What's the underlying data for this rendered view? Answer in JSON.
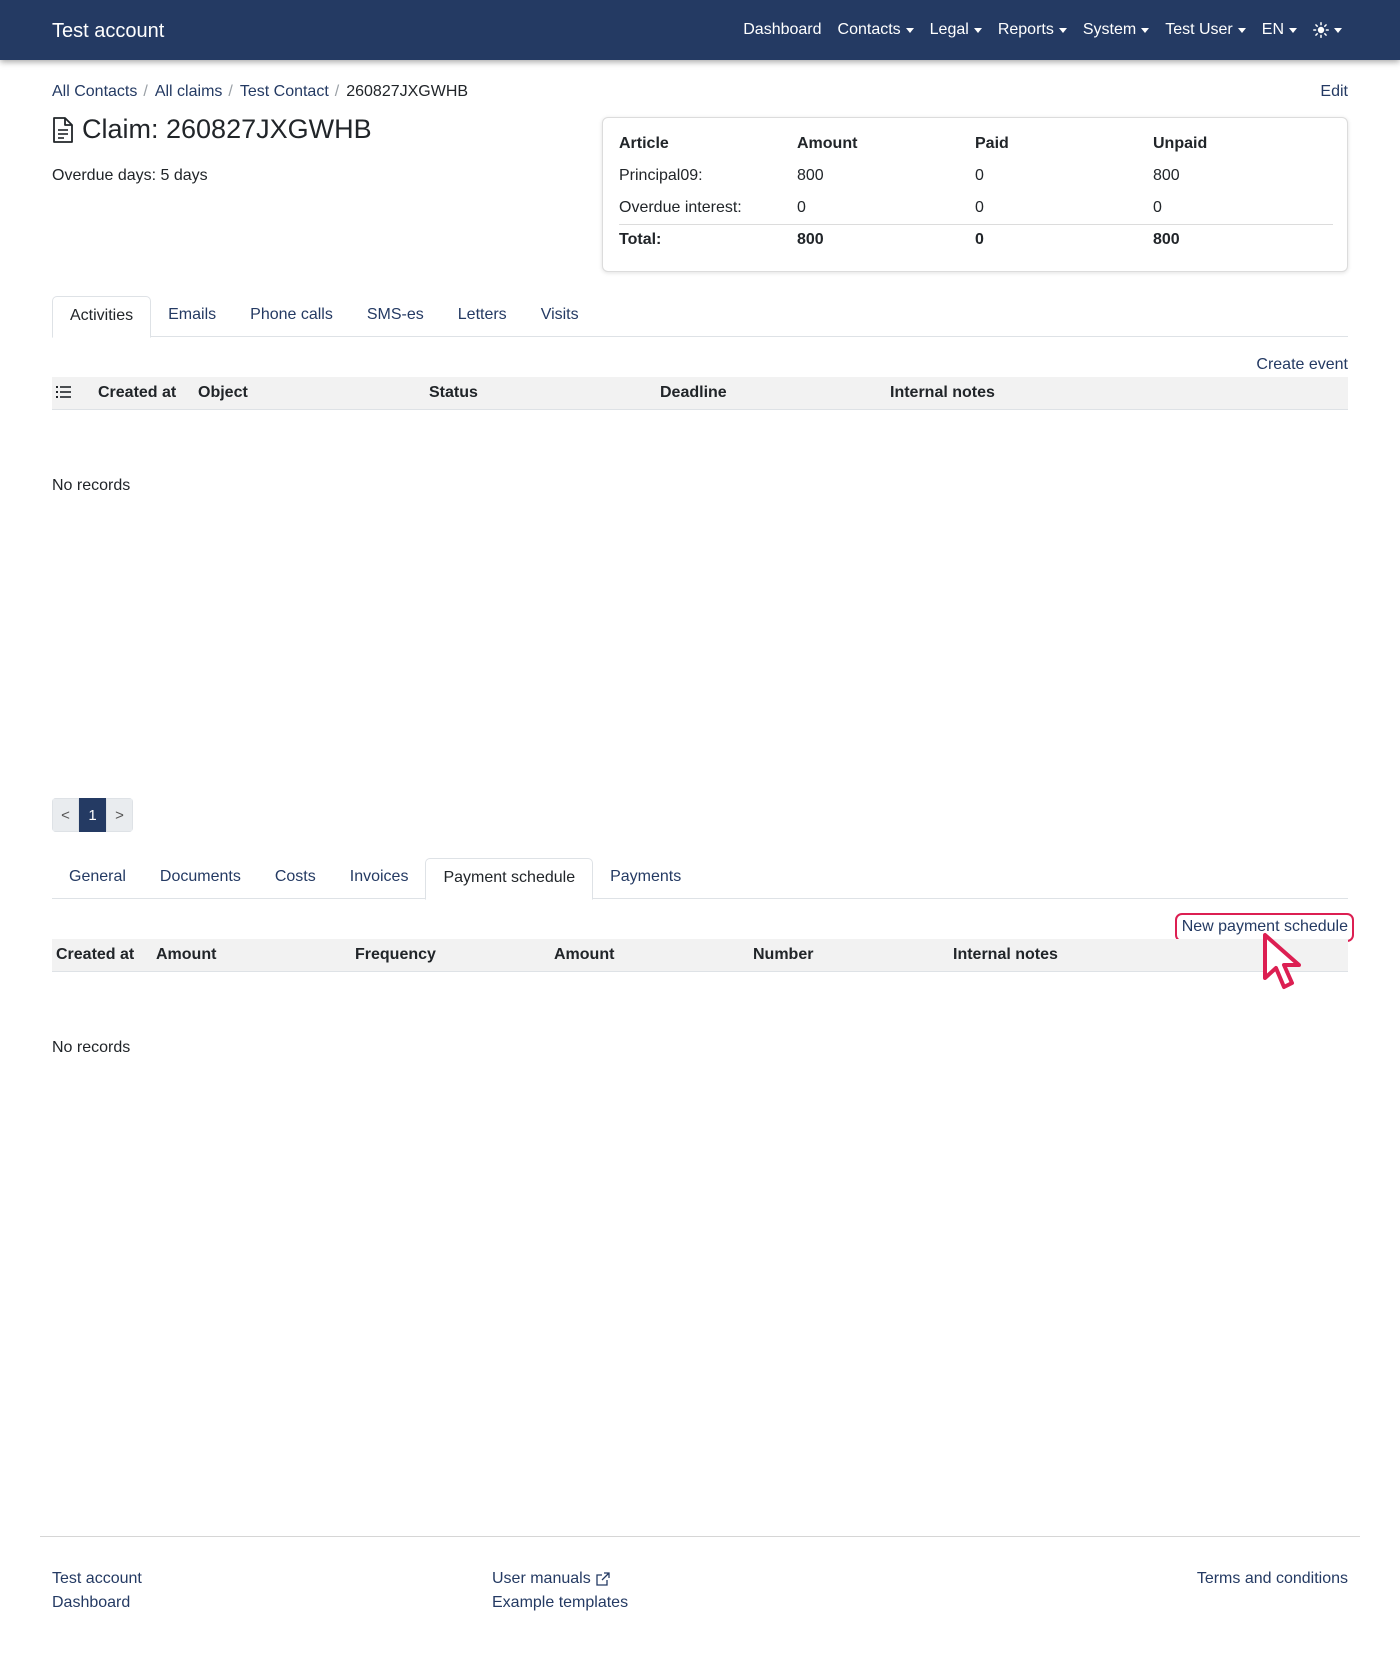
{
  "navbar": {
    "brand": "Test account",
    "items": [
      {
        "label": "Dashboard",
        "dropdown": false
      },
      {
        "label": "Contacts",
        "dropdown": true
      },
      {
        "label": "Legal",
        "dropdown": true
      },
      {
        "label": "Reports",
        "dropdown": true
      },
      {
        "label": "System",
        "dropdown": true
      },
      {
        "label": "Test User",
        "dropdown": true
      },
      {
        "label": "EN",
        "dropdown": true
      }
    ],
    "theme_icon": "sun-icon"
  },
  "breadcrumb": [
    "All Contacts",
    "All claims",
    "Test Contact",
    "260827JXGWHB"
  ],
  "edit_label": "Edit",
  "title": "Claim: 260827JXGWHB",
  "overdue": "Overdue days: 5 days",
  "summary": {
    "headers": [
      "Article",
      "Amount",
      "Paid",
      "Unpaid"
    ],
    "rows": [
      [
        "Principal09:",
        "800",
        "0",
        "800"
      ],
      [
        "Overdue interest:",
        "0",
        "0",
        "0"
      ]
    ],
    "total": [
      "Total:",
      "800",
      "0",
      "800"
    ]
  },
  "activity_tabs": [
    "Activities",
    "Emails",
    "Phone calls",
    "SMS-es",
    "Letters",
    "Visits"
  ],
  "activity_action": "Create event",
  "activity_columns": [
    "Created at",
    "Object",
    "Status",
    "Deadline",
    "Internal notes"
  ],
  "activity_empty": "No records",
  "pagination": {
    "prev": "<",
    "current": "1",
    "next": ">"
  },
  "claim_tabs": [
    "General",
    "Documents",
    "Costs",
    "Invoices",
    "Payment schedule",
    "Payments"
  ],
  "schedule_action": "New payment schedule",
  "schedule_columns": [
    "Created at",
    "Amount",
    "Frequency",
    "Amount",
    "Number",
    "Internal notes"
  ],
  "schedule_empty": "No records",
  "footer": {
    "col1": [
      "Test account",
      "Dashboard"
    ],
    "col2": [
      "User manuals",
      "Example templates"
    ],
    "col3": [
      "Terms and conditions"
    ]
  },
  "colors": {
    "navbar": "#243a63",
    "link": "#243a63",
    "highlight": "#dc1f52"
  }
}
